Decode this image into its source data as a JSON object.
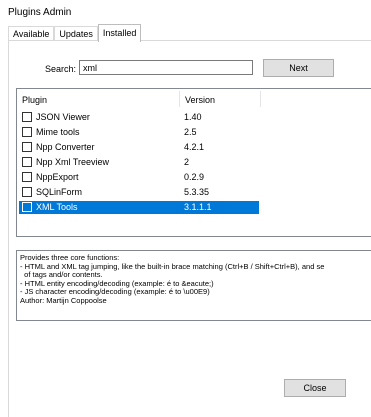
{
  "window": {
    "title": "Plugins Admin"
  },
  "tabs": [
    {
      "label": "Available"
    },
    {
      "label": "Updates"
    },
    {
      "label": "Installed",
      "active": true
    }
  ],
  "search": {
    "label": "Search:",
    "value": "xml",
    "next_label": "Next"
  },
  "plugin_list": {
    "columns": {
      "plugin": "Plugin",
      "version": "Version"
    },
    "rows": [
      {
        "name": "JSON Viewer",
        "version": "1.40",
        "checked": false
      },
      {
        "name": "Mime tools",
        "version": "2.5",
        "checked": false
      },
      {
        "name": "Npp Converter",
        "version": "4.2.1",
        "checked": false
      },
      {
        "name": "Npp Xml Treeview",
        "version": "2",
        "checked": false
      },
      {
        "name": "NppExport",
        "version": "0.2.9",
        "checked": false
      },
      {
        "name": "SQLinForm",
        "version": "5.3.35",
        "checked": false
      },
      {
        "name": "XML Tools",
        "version": "3.1.1.1",
        "checked": false,
        "selected": true
      }
    ]
  },
  "description": {
    "lines": [
      "Provides three core functions:",
      "- HTML and XML tag jumping, like the built-in brace matching (Ctrl+B / Shift+Ctrl+B), and se",
      "  of tags and/or contents.",
      "- HTML entity encoding/decoding (example: é to &eacute;)",
      "- JS character encoding/decoding (example: é to \\u00E9)",
      "Author: Martijn Coppoolse"
    ]
  },
  "footer": {
    "close_label": "Close"
  },
  "colors": {
    "selection": "#0078d7",
    "button_face": "#e1e1e1"
  }
}
